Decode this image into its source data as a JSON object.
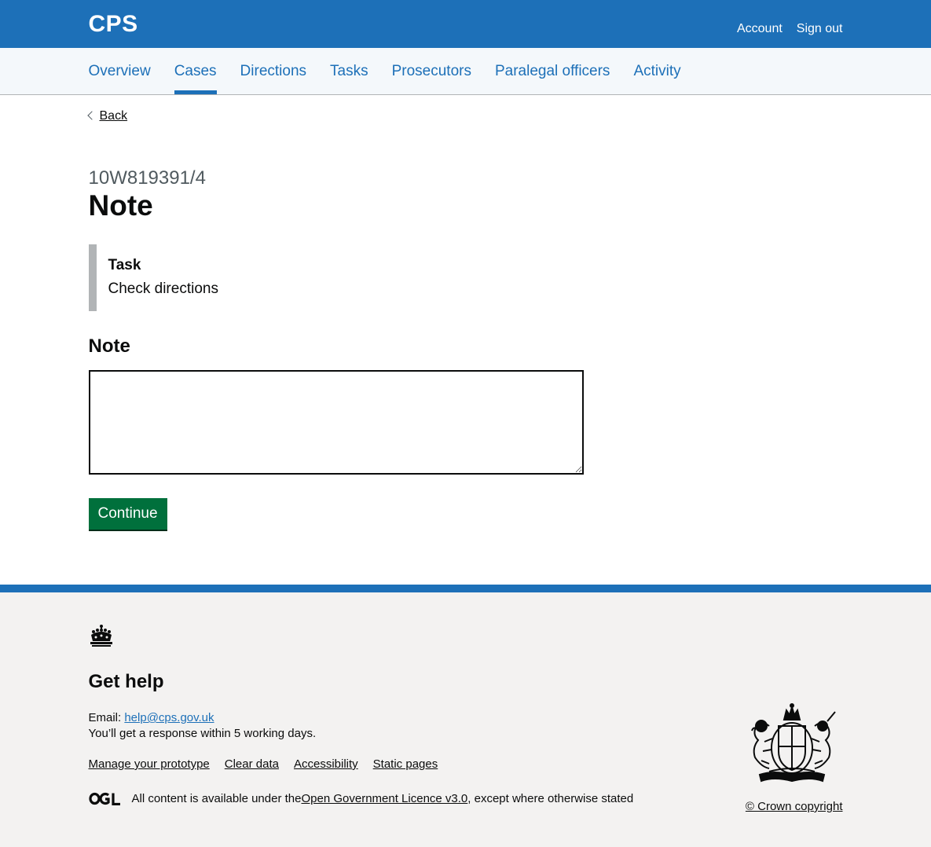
{
  "header": {
    "logo": "CPS",
    "links": [
      "Account",
      "Sign out"
    ]
  },
  "nav": {
    "items": [
      "Overview",
      "Cases",
      "Directions",
      "Tasks",
      "Prosecutors",
      "Paralegal officers",
      "Activity"
    ],
    "active": "Cases"
  },
  "main": {
    "back_label": "Back",
    "caption": "10W819391/4",
    "title": "Note",
    "inset": {
      "label": "Task",
      "value": "Check directions"
    },
    "field_label": "Note",
    "textarea_value": "",
    "button_label": "Continue"
  },
  "footer": {
    "heading": "Get help",
    "email_prefix": "Email: ",
    "email": "help@cps.gov.uk",
    "response_text": "You’ll get a response within 5 working days.",
    "links": [
      "Manage your prototype",
      "Clear data",
      "Accessibility",
      "Static pages"
    ],
    "licence_prefix": "All content is available under the ",
    "licence_link": "Open Government Licence v3.0",
    "licence_suffix": ", except where otherwise stated",
    "ogl_logo": "ogl-icon",
    "copyright": "© Crown copyright"
  },
  "colors": {
    "brand_blue": "#1d70b8",
    "button_green": "#00703c",
    "footer_bg": "#f3f2f1",
    "nav_bg": "#f4f8fb"
  }
}
